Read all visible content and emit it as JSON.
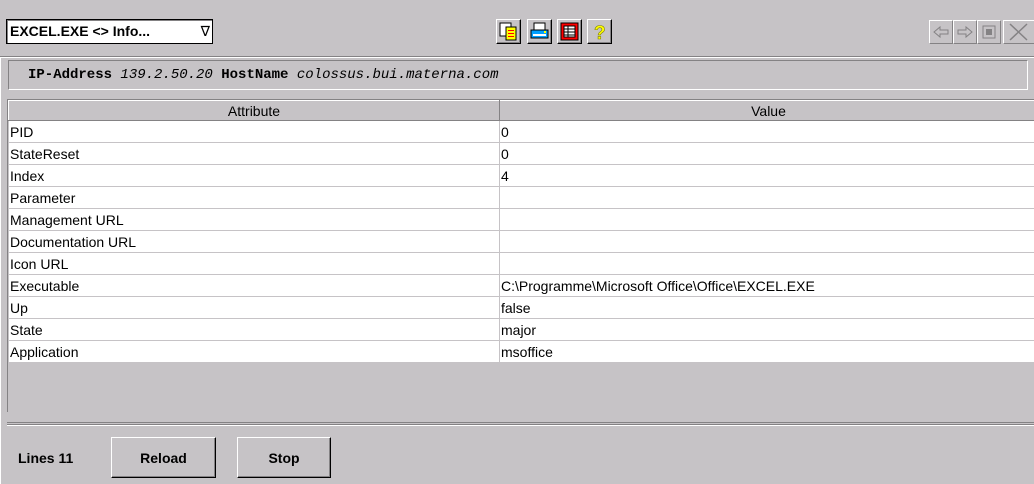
{
  "toolbar": {
    "title": "EXCEL.EXE <> Info...",
    "dropdown_glyph": "∇",
    "buttons": [
      {
        "icon": "copy-icon"
      },
      {
        "icon": "print-icon"
      },
      {
        "icon": "table-icon"
      },
      {
        "icon": "help-icon"
      }
    ],
    "nav": [
      {
        "icon": "back-arrow-icon"
      },
      {
        "icon": "forward-arrow-icon"
      },
      {
        "icon": "stop-icon"
      },
      {
        "icon": "close-icon"
      }
    ]
  },
  "host": {
    "ip_label": "IP-Address",
    "ip_value": "139.2.50.20",
    "host_label": "HostName",
    "host_value": "colossus.bui.materna.com"
  },
  "table": {
    "columns": [
      "Attribute",
      "Value"
    ],
    "rows": [
      [
        "PID",
        "0"
      ],
      [
        "StateReset",
        "0"
      ],
      [
        "Index",
        "4"
      ],
      [
        "Parameter",
        ""
      ],
      [
        "Management URL",
        ""
      ],
      [
        "Documentation URL",
        ""
      ],
      [
        "Icon URL",
        ""
      ],
      [
        "Executable",
        "C:\\Programme\\Microsoft Office\\Office\\EXCEL.EXE"
      ],
      [
        "Up",
        "false"
      ],
      [
        "State",
        "major"
      ],
      [
        "Application",
        "msoffice"
      ]
    ]
  },
  "footer": {
    "lines_label": "Lines 11",
    "reload_label": "Reload",
    "stop_label": "Stop"
  }
}
